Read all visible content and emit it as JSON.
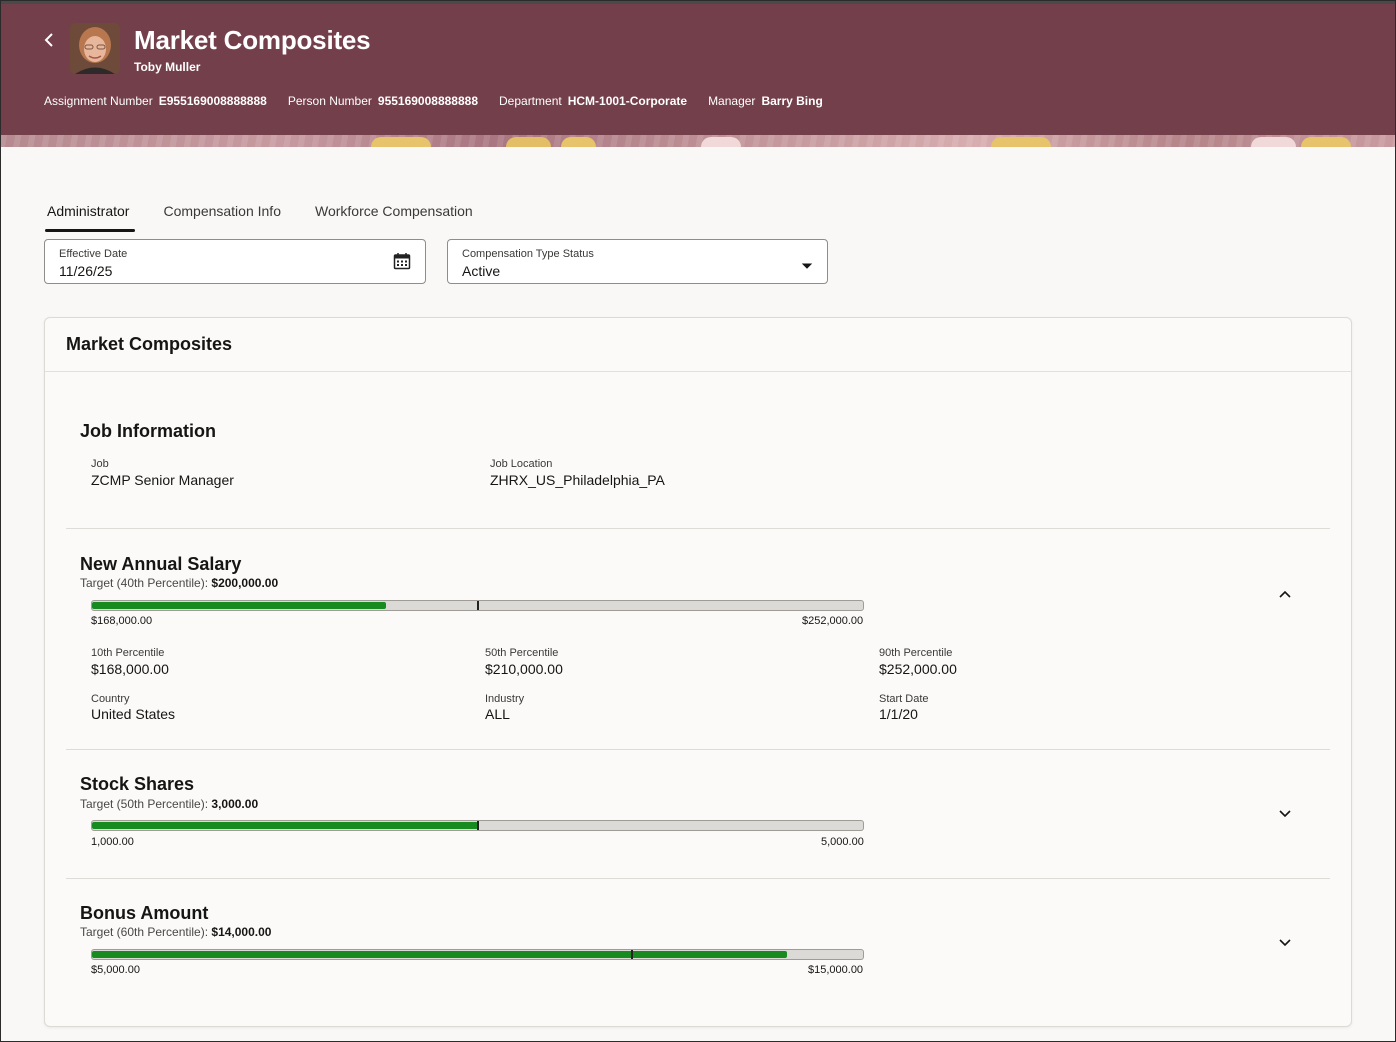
{
  "header": {
    "title": "Market Composites",
    "person_name": "Toby Muller",
    "meta": [
      {
        "label": "Assignment Number",
        "value": "E955169008888888"
      },
      {
        "label": "Person Number",
        "value": "955169008888888"
      },
      {
        "label": "Department",
        "value": "HCM-1001-Corporate"
      },
      {
        "label": "Manager",
        "value": "Barry Bing"
      }
    ],
    "accent_color": "#733f4b"
  },
  "tabs": [
    {
      "label": "Administrator",
      "active": true
    },
    {
      "label": "Compensation Info",
      "active": false
    },
    {
      "label": "Workforce Compensation",
      "active": false
    }
  ],
  "filters": {
    "effective_date": {
      "label": "Effective Date",
      "value": "11/26/25",
      "icon": "calendar-icon"
    },
    "status": {
      "label": "Compensation Type Status",
      "value": "Active",
      "icon": "caret-down-icon"
    }
  },
  "card": {
    "title": "Market Composites",
    "job_info": {
      "title": "Job Information",
      "job_label": "Job",
      "job_value": "ZCMP Senior Manager",
      "location_label": "Job Location",
      "location_value": "ZHRX_US_Philadelphia_PA"
    },
    "salary": {
      "title": "New Annual Salary",
      "target_label": "Target (40th Percentile): ",
      "target_value": "$200,000.00",
      "min_label": "$168,000.00",
      "max_label": "$252,000.00",
      "fill_fraction": 0.381,
      "marker_fraction": 0.5,
      "expanded": true,
      "details": [
        {
          "label": "10th Percentile",
          "value": "$168,000.00"
        },
        {
          "label": "50th Percentile",
          "value": "$210,000.00"
        },
        {
          "label": "90th Percentile",
          "value": "$252,000.00"
        },
        {
          "label": "Country",
          "value": "United States"
        },
        {
          "label": "Industry",
          "value": "ALL"
        },
        {
          "label": "Start Date",
          "value": "1/1/20"
        }
      ]
    },
    "stock": {
      "title": "Stock Shares",
      "target_label": "Target (50th Percentile): ",
      "target_value": "3,000.00",
      "min_label": "1,000.00",
      "max_label": "5,000.00",
      "fill_fraction": 0.5,
      "marker_fraction": 0.5,
      "expanded": false
    },
    "bonus": {
      "title": "Bonus Amount",
      "target_label": "Target (60th Percentile): ",
      "target_value": "$14,000.00",
      "min_label": "$5,000.00",
      "max_label": "$15,000.00",
      "fill_fraction": 0.902,
      "marker_fraction": 0.7,
      "expanded": false
    }
  }
}
